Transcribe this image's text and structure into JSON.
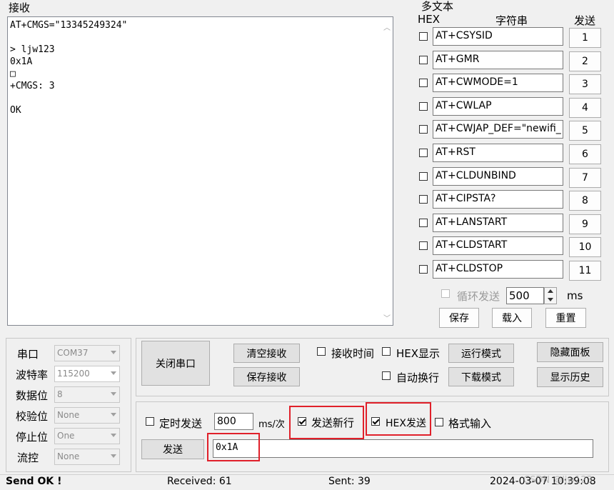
{
  "receive": {
    "title": "接收",
    "lines": [
      "AT+CMGS=\"13345249324\"",
      "",
      "> ljw123",
      "0x1A",
      "□",
      "+CMGS: 3",
      "",
      "OK"
    ]
  },
  "multi": {
    "title": "多文本",
    "col_hex": "HEX",
    "col_string": "字符串",
    "col_send": "发送",
    "rows": [
      {
        "value": "AT+CSYSID",
        "num": "1"
      },
      {
        "value": "AT+GMR",
        "num": "2"
      },
      {
        "value": "AT+CWMODE=1",
        "num": "3"
      },
      {
        "value": "AT+CWLAP",
        "num": "4"
      },
      {
        "value": "AT+CWJAP_DEF=\"newifi_",
        "num": "5"
      },
      {
        "value": "AT+RST",
        "num": "6"
      },
      {
        "value": "AT+CLDUNBIND",
        "num": "7"
      },
      {
        "value": "AT+CIPSTA?",
        "num": "8"
      },
      {
        "value": "AT+LANSTART",
        "num": "9"
      },
      {
        "value": "AT+CLDSTART",
        "num": "10"
      },
      {
        "value": "AT+CLDSTOP",
        "num": "11"
      }
    ],
    "loop_label": "循环发送",
    "loop_value": "500",
    "loop_unit": "ms",
    "save": "保存",
    "load": "载入",
    "reset": "重置"
  },
  "serial": {
    "port_label": "串口",
    "port_value": "COM37",
    "baud_label": "波特率",
    "baud_value": "115200",
    "data_label": "数据位",
    "data_value": "8",
    "parity_label": "校验位",
    "parity_value": "None",
    "stop_label": "停止位",
    "stop_value": "One",
    "flow_label": "流控",
    "flow_value": "None"
  },
  "controls": {
    "close_port": "关闭串口",
    "clear_rx": "清空接收",
    "save_rx": "保存接收",
    "rx_time": "接收时间",
    "hex_display": "HEX显示",
    "auto_wrap": "自动换行",
    "run_mode": "运行模式",
    "download_mode": "下载模式",
    "hide_panel": "隐藏面板",
    "show_history": "显示历史"
  },
  "send": {
    "timed": "定时发送",
    "interval": "800",
    "interval_unit": "ms/次",
    "newline": "发送新行",
    "hex_send": "HEX发送",
    "format_input": "格式输入",
    "send_button": "发送",
    "input_value": "0x1A"
  },
  "status": {
    "message": "Send OK !",
    "received": "Received: 61",
    "sent": "Sent: 39",
    "datetime": "2024-03-07 10:39:08",
    "watermark": "CSDN @ljw123"
  },
  "colors": {
    "highlight": "#e0202a"
  }
}
